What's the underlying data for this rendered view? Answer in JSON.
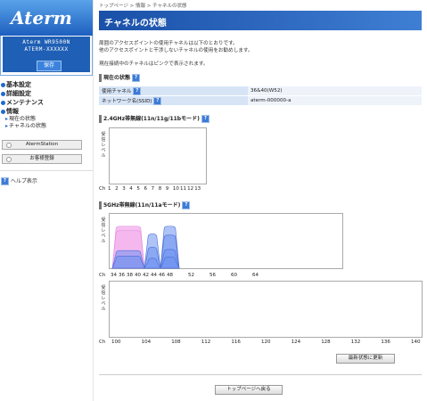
{
  "sidebar": {
    "logo": "Aterm",
    "model": "Aterm WR9500N",
    "ssid": "ATERM-XXXXXX",
    "save_label": "保存",
    "menu": [
      {
        "label": "基本設定"
      },
      {
        "label": "詳細設定"
      },
      {
        "label": "メンテナンス"
      },
      {
        "label": "情報"
      }
    ],
    "submenu": [
      "現在の状態",
      "チャネルの状態"
    ],
    "buttons": [
      "AtermStation",
      "お客様登録"
    ],
    "help_label": "ヘルプ表示"
  },
  "breadcrumb": "トップページ > 情報 > チャネルの状態",
  "page_title": "チャネルの状態",
  "desc": {
    "line1": "周囲のアクセスポイントの使用チャネルは以下のとおりです。",
    "line2": "他のアクセスポイントと干渉しないチャネルの使用をお勧めします。",
    "line3": "現在接続中のチャネルはピンクで表示されます。"
  },
  "current": {
    "heading": "現在の状態",
    "rows": [
      {
        "key": "使用チャネル",
        "value": "36&40(W52)"
      },
      {
        "key": "ネットワーク名(SSID)",
        "value": "aterm-000000-a"
      }
    ]
  },
  "band24": {
    "heading": "2.4GHz帯無線(11n/11g/11bモード)",
    "ylabel": "受信レベル",
    "ch_prefix": "Ch",
    "ticks": [
      "1",
      "2",
      "3",
      "4",
      "5",
      "6",
      "7",
      "8",
      "9",
      "10",
      "11",
      "12",
      "13"
    ]
  },
  "band5": {
    "heading": "5GHz帯無線(11n/11aモード)",
    "ylabel": "受信レベル",
    "ch_prefix": "Ch",
    "ticks_low": [
      "34",
      "36",
      "38",
      "40",
      "42",
      "44",
      "46",
      "48",
      "52",
      "56",
      "60",
      "64"
    ],
    "ticks_high": [
      "100",
      "104",
      "108",
      "112",
      "116",
      "120",
      "124",
      "128",
      "132",
      "136",
      "140"
    ],
    "colors": {
      "current": "#f3b6ee",
      "other": "#6d92f0"
    }
  },
  "chart_data": [
    {
      "type": "area",
      "title": "5GHz帯無線(11n/11aモード)",
      "ylabel": "受信レベル",
      "xlabel": "Ch",
      "series": [
        {
          "channels": [
            34,
            42
          ],
          "level": 0.76,
          "current": true
        },
        {
          "channels": [
            34,
            42
          ],
          "level": 0.68,
          "current": true
        },
        {
          "channels": [
            34,
            42
          ],
          "level": 0.32
        },
        {
          "channels": [
            34,
            42
          ],
          "level": 0.22
        },
        {
          "channels": [
            42,
            46
          ],
          "level": 0.62
        },
        {
          "channels": [
            42,
            46
          ],
          "level": 0.38
        },
        {
          "channels": [
            42,
            46
          ],
          "level": 0.18
        },
        {
          "channels": [
            46,
            50
          ],
          "level": 0.76
        },
        {
          "channels": [
            46,
            50
          ],
          "level": 0.6
        },
        {
          "channels": [
            46,
            50
          ],
          "level": 0.34
        },
        {
          "channels": [
            46,
            50
          ],
          "level": 0.2
        }
      ]
    }
  ],
  "refresh_label": "最新状態に更新",
  "back_label": "トップページへ戻る"
}
